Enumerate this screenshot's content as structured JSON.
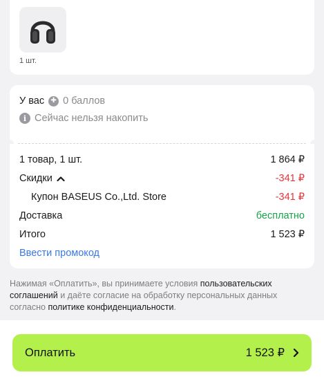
{
  "product": {
    "quantity_label": "1 шт."
  },
  "bonus": {
    "prefix": "У вас",
    "points": "0 баллов",
    "notice": "Сейчас нельзя накопить"
  },
  "summary": {
    "items_label": "1 товар, 1 шт.",
    "items_price": "1 864 ₽",
    "discounts_label": "Скидки",
    "discounts_value": "-341 ₽",
    "coupon_label": "Купон BASEUS Co.,Ltd. Store",
    "coupon_value": "-341 ₽",
    "delivery_label": "Доставка",
    "delivery_value": "бесплатно",
    "total_label": "Итого",
    "total_value": "1 523 ₽",
    "promo_link": "Ввести промокод"
  },
  "legal": {
    "part1": "Нажимая «Оплатить», вы принимаете условия ",
    "link1": "пользовательских соглашений",
    "part2": " и даёте согласие на обработку персональных данных согласно ",
    "link2": "политике конфиденциальности",
    "part3": "."
  },
  "pay_button": {
    "label": "Оплатить",
    "amount": "1 523 ₽"
  }
}
